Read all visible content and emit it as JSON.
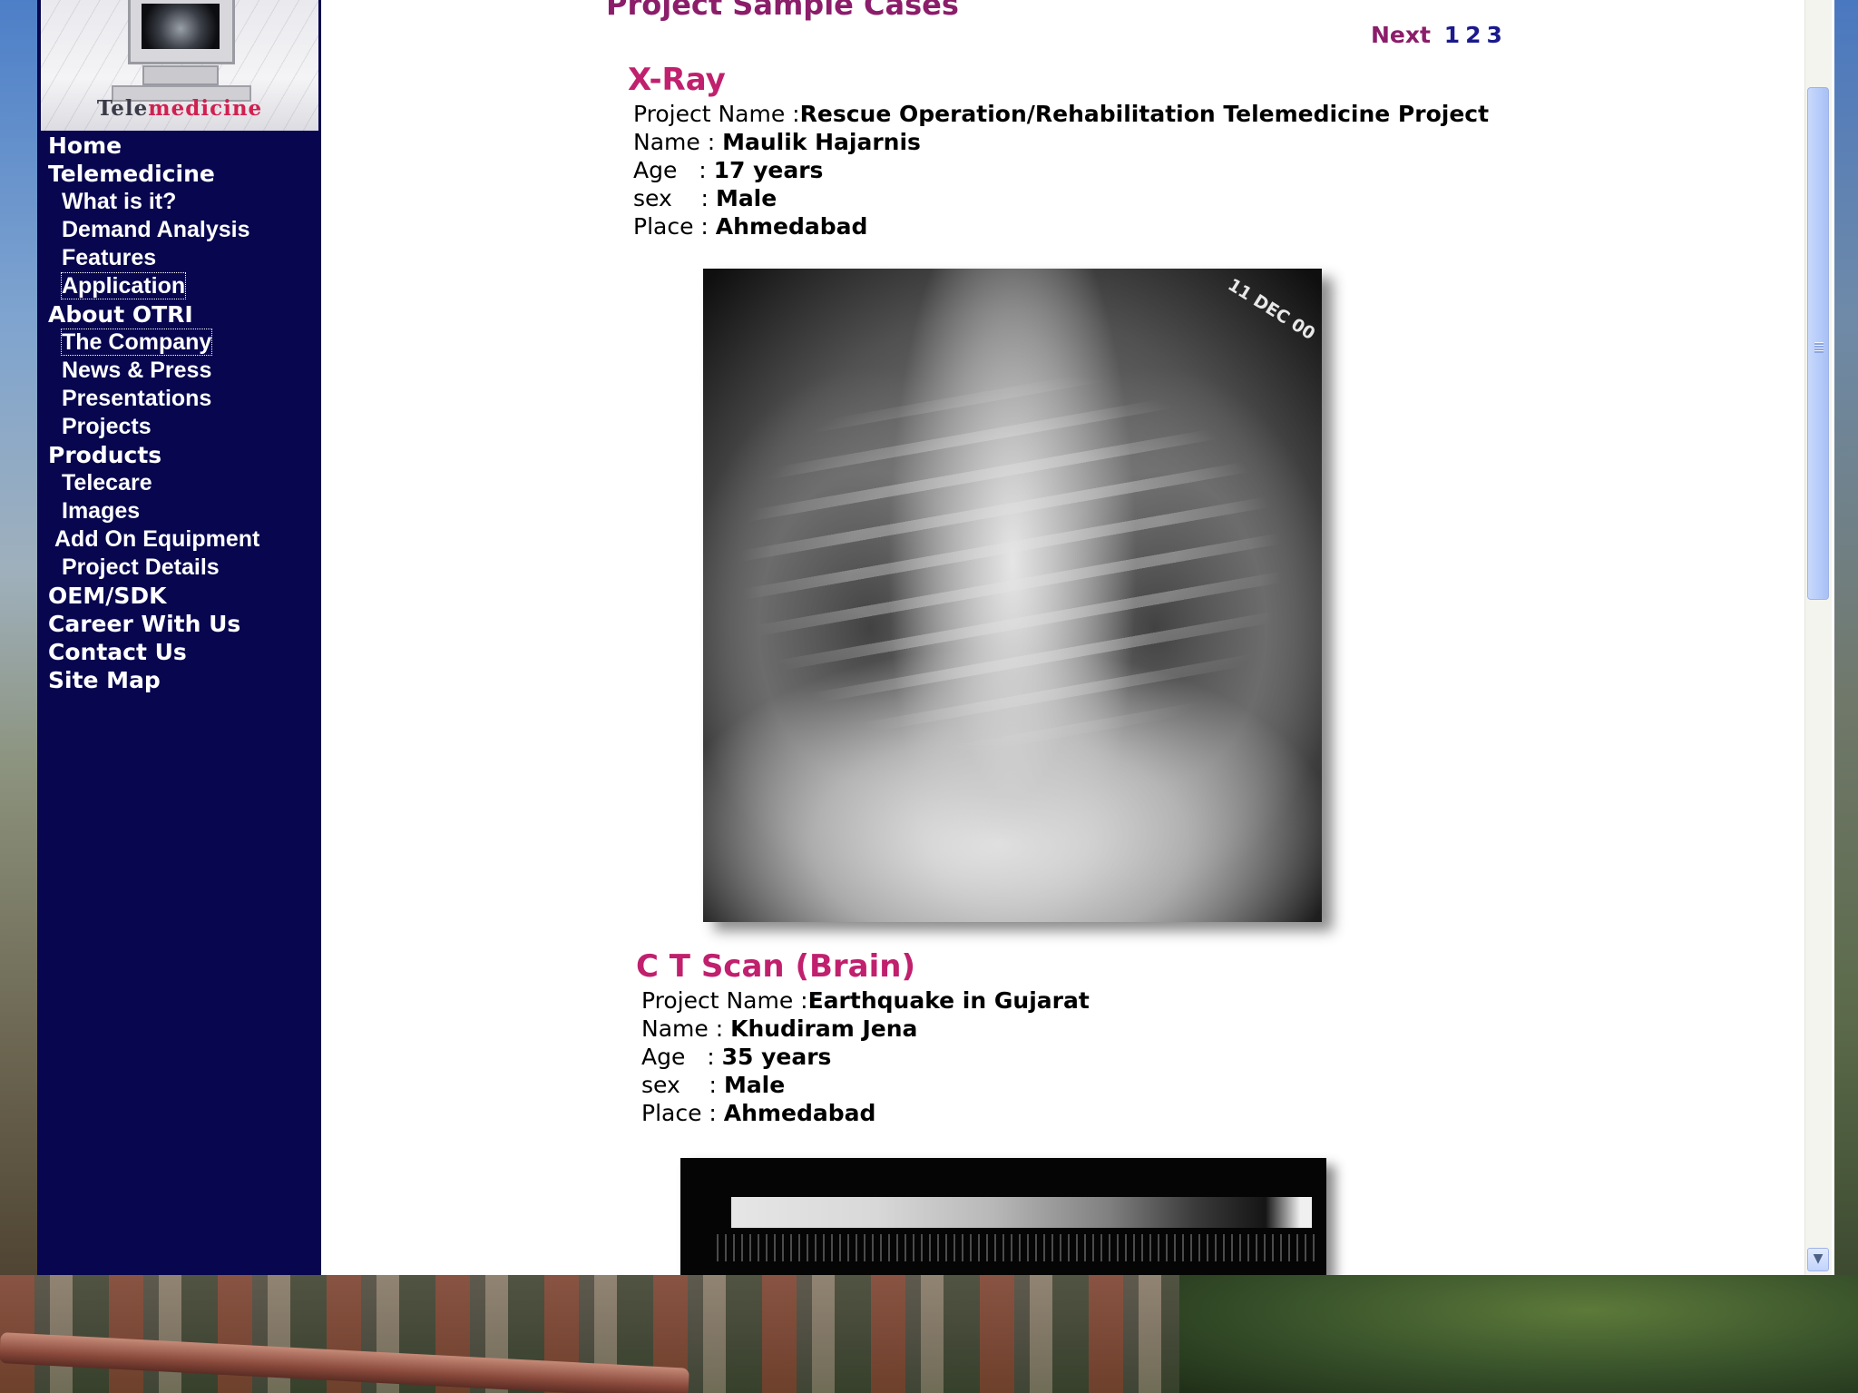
{
  "logo": {
    "brand_prefix": "Tele",
    "brand_accent": "medicine"
  },
  "nav": [
    {
      "label": "Home",
      "level": 0
    },
    {
      "label": "Telemedicine",
      "level": 0
    },
    {
      "label": "What is it?",
      "level": 1
    },
    {
      "label": "Demand Analysis",
      "level": 1
    },
    {
      "label": "Features",
      "level": 1
    },
    {
      "label": "Application",
      "level": 1
    },
    {
      "label": "About OTRI",
      "level": 0
    },
    {
      "label": "The Company",
      "level": 1
    },
    {
      "label": "News & Press",
      "level": 1
    },
    {
      "label": "Presentations",
      "level": 1
    },
    {
      "label": "Projects",
      "level": 1
    },
    {
      "label": "Products",
      "level": 0
    },
    {
      "label": "Telecare",
      "level": 1
    },
    {
      "label": "Images",
      "level": 1
    },
    {
      "label": "Add On Equipment",
      "level": 1
    },
    {
      "label": "Project Details",
      "level": 1
    },
    {
      "label": "OEM/SDK",
      "level": 0
    },
    {
      "label": "Career With Us",
      "level": 0
    },
    {
      "label": "Contact Us",
      "level": 0
    },
    {
      "label": "Site Map",
      "level": 0
    }
  ],
  "content": {
    "heading": "Project Sample Cases",
    "pager": {
      "next_label": "Next",
      "pages": [
        "1",
        "2",
        "3"
      ]
    },
    "cases": [
      {
        "title": "X-Ray",
        "project_label": "Project Name :",
        "project_value": "Rescue Operation/Rehabilitation Telemedicine Project",
        "name_label": "Name :",
        "name_value": "Maulik Hajarnis",
        "age_label": "Age   :",
        "age_value": "17 years",
        "sex_label": "sex    :",
        "sex_value": "Male",
        "place_label": "Place :",
        "place_value": "Ahmedabad",
        "image_stamp": "11 DEC 00"
      },
      {
        "title": "C T Scan (Brain)",
        "project_label": "Project Name :",
        "project_value": "Earthquake in Gujarat",
        "name_label": "Name :",
        "name_value": "Khudiram Jena",
        "age_label": "Age   :",
        "age_value": "35 years",
        "sex_label": "sex    :",
        "sex_value": "Male",
        "place_label": "Place :",
        "place_value": "Ahmedabad"
      }
    ]
  },
  "scrollbar": {
    "position_fraction": 0.07,
    "visible_fraction": 0.41
  },
  "colors": {
    "sidebar_bg": "#07064f",
    "heading": "#8b1d6a",
    "case_title": "#c0206e",
    "pager_num": "#1a1a8c"
  }
}
